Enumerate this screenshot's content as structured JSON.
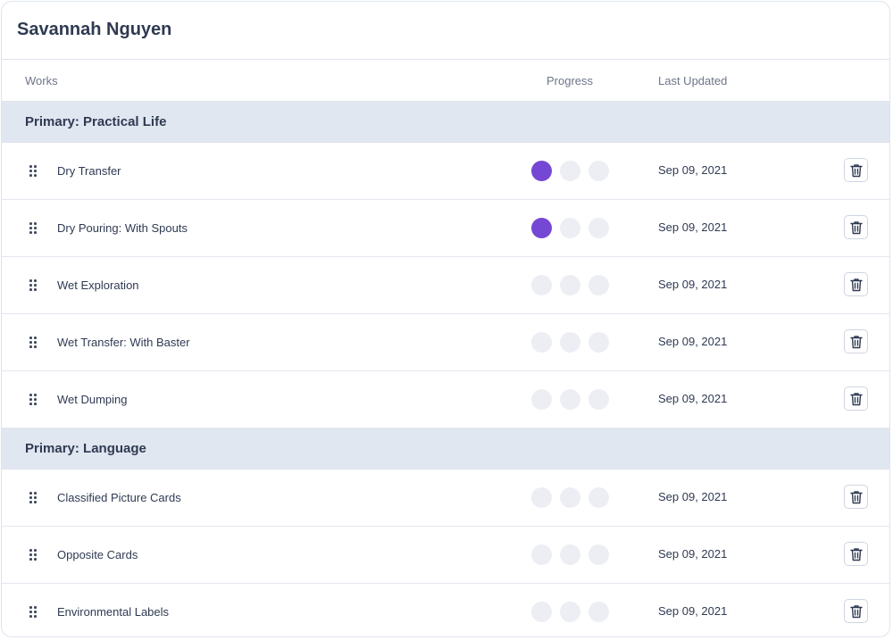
{
  "student_name": "Savannah Nguyen",
  "columns": {
    "works": "Works",
    "progress": "Progress",
    "last_updated": "Last Updated"
  },
  "groups": [
    {
      "name": "Primary: Practical Life",
      "rows": [
        {
          "name": "Dry Transfer",
          "progress_level": 1,
          "progress_max": 3,
          "date": "Sep 09, 2021"
        },
        {
          "name": "Dry Pouring: With Spouts",
          "progress_level": 1,
          "progress_max": 3,
          "date": "Sep 09, 2021"
        },
        {
          "name": "Wet Exploration",
          "progress_level": 0,
          "progress_max": 3,
          "date": "Sep 09, 2021"
        },
        {
          "name": "Wet Transfer: With Baster",
          "progress_level": 0,
          "progress_max": 3,
          "date": "Sep 09, 2021"
        },
        {
          "name": "Wet Dumping",
          "progress_level": 0,
          "progress_max": 3,
          "date": "Sep 09, 2021"
        }
      ]
    },
    {
      "name": "Primary: Language",
      "rows": [
        {
          "name": "Classified Picture Cards",
          "progress_level": 0,
          "progress_max": 3,
          "date": "Sep 09, 2021"
        },
        {
          "name": "Opposite Cards",
          "progress_level": 0,
          "progress_max": 3,
          "date": "Sep 09, 2021"
        },
        {
          "name": "Environmental Labels",
          "progress_level": 0,
          "progress_max": 3,
          "date": "Sep 09, 2021"
        }
      ]
    }
  ],
  "colors": {
    "progress_filled": "#7448d4",
    "progress_empty": "#eceef4",
    "group_header_bg": "#e1e7f1"
  },
  "icons": {
    "row_drag": "drag-handle-icon",
    "row_delete": "trash-icon"
  }
}
